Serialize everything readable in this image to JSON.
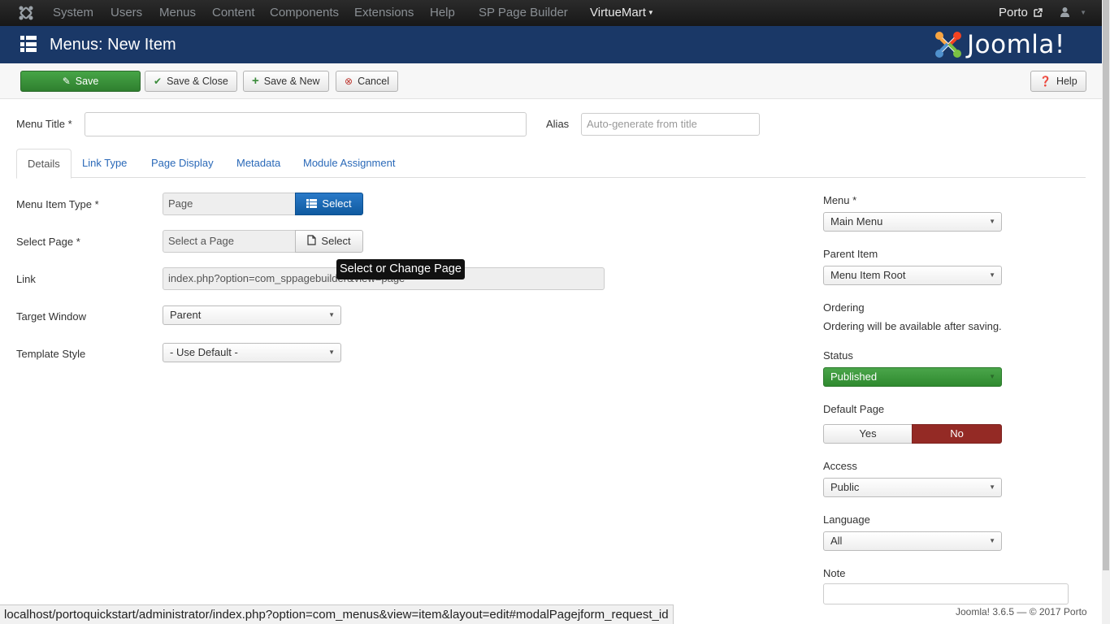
{
  "navbar": {
    "items": [
      "System",
      "Users",
      "Menus",
      "Content",
      "Components",
      "Extensions",
      "Help",
      "SP Page Builder",
      "VirtueMart"
    ],
    "site_name": "Porto"
  },
  "header": {
    "title": "Menus: New Item",
    "brand": "Joomla!"
  },
  "toolbar": {
    "save": "Save",
    "save_close": "Save & Close",
    "save_new": "Save & New",
    "cancel": "Cancel",
    "help": "Help"
  },
  "form": {
    "menu_title_label": "Menu Title *",
    "menu_title_value": "",
    "alias_label": "Alias",
    "alias_placeholder": "Auto-generate from title"
  },
  "tabs": [
    "Details",
    "Link Type",
    "Page Display",
    "Metadata",
    "Module Assignment"
  ],
  "details": {
    "menu_item_type_label": "Menu Item Type *",
    "menu_item_type_value": "Page",
    "menu_item_type_button": "Select",
    "select_page_label": "Select Page *",
    "select_page_value": "Select a Page",
    "select_page_button": "Select",
    "tooltip": "Select or Change Page",
    "link_label": "Link",
    "link_value": "index.php?option=com_sppagebuilder&view=page",
    "target_window_label": "Target Window",
    "target_window_value": "Parent",
    "template_style_label": "Template Style",
    "template_style_value": "- Use Default -"
  },
  "sidebar": {
    "menu_label": "Menu *",
    "menu_value": "Main Menu",
    "parent_label": "Parent Item",
    "parent_value": "Menu Item Root",
    "ordering_label": "Ordering",
    "ordering_text": "Ordering will be available after saving.",
    "status_label": "Status",
    "status_value": "Published",
    "default_page_label": "Default Page",
    "default_yes": "Yes",
    "default_no": "No",
    "access_label": "Access",
    "access_value": "Public",
    "language_label": "Language",
    "language_value": "All",
    "note_label": "Note"
  },
  "statusbar": {
    "url": "localhost/portoquickstart/administrator/index.php?option=com_menus&view=item&layout=edit#modalPagejform_request_id"
  },
  "footer": {
    "text": "Joomla! 3.6.5  —  © 2017 Porto"
  },
  "colors": {
    "navbar": "#1c1c1c",
    "subhead": "#1a3867",
    "save_green": "#3b8b3b",
    "link_blue": "#2a69b8",
    "select_blue": "#1565b0",
    "no_red": "#942a25"
  }
}
